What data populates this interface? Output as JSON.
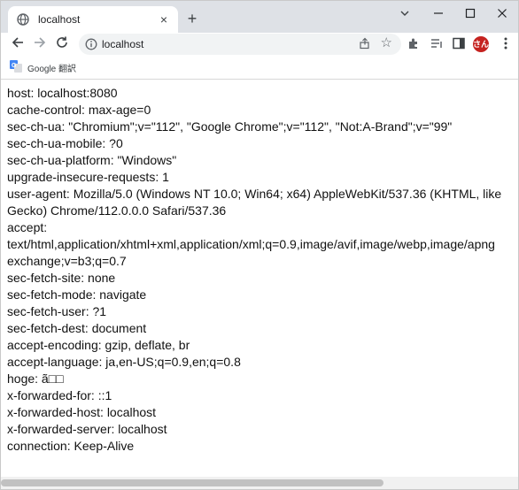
{
  "tab": {
    "title": "localhost",
    "close_label": "×",
    "new_tab_label": "+"
  },
  "window_controls": {
    "dropdown": "chevron-down-icon",
    "minimize": "minimize-icon",
    "maximize": "maximize-icon",
    "close": "close-icon"
  },
  "omnibox": {
    "url": "localhost"
  },
  "profile": {
    "avatar_text": "さん"
  },
  "bookmarks": [
    {
      "label": "Google 翻訳"
    }
  ],
  "content_lines": [
    "host: localhost:8080",
    "cache-control: max-age=0",
    "sec-ch-ua: \"Chromium\";v=\"112\", \"Google Chrome\";v=\"112\", \"Not:A-Brand\";v=\"99\"",
    "sec-ch-ua-mobile: ?0",
    "sec-ch-ua-platform: \"Windows\"",
    "upgrade-insecure-requests: 1",
    "user-agent: Mozilla/5.0 (Windows NT 10.0; Win64; x64) AppleWebKit/537.36 (KHTML, like",
    "Gecko) Chrome/112.0.0.0 Safari/537.36",
    "accept:",
    "text/html,application/xhtml+xml,application/xml;q=0.9,image/avif,image/webp,image/apng",
    "exchange;v=b3;q=0.7",
    "sec-fetch-site: none",
    "sec-fetch-mode: navigate",
    "sec-fetch-user: ?1",
    "sec-fetch-dest: document",
    "accept-encoding: gzip, deflate, br",
    "accept-language: ja,en-US;q=0.9,en;q=0.8",
    "hoge: ã□□",
    "x-forwarded-for: ::1",
    "x-forwarded-host: localhost",
    "x-forwarded-server: localhost",
    "connection: Keep-Alive"
  ]
}
